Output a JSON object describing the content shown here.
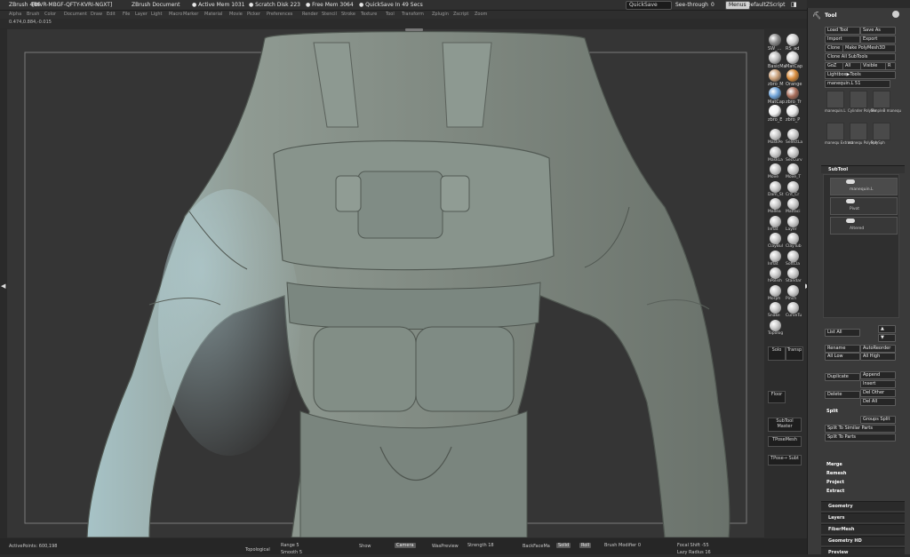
{
  "titlebar": {
    "app": "ZBrush 4R6",
    "serial": "[BIVR-MBGF-QFTY-KVRI-NGXT]",
    "document": "ZBrush Document",
    "active_mem": "● Active Mem 1031",
    "scratch": "● Scratch Disk 223",
    "free_mem": "● Free Mem 3064",
    "quicksave_in": "● QuickSave In 49 Secs",
    "quicksave_btn": "QuickSave",
    "see_through": "See-through",
    "see_through_val": "0",
    "menus_btn": "Menus",
    "script": "DefaultZScript"
  },
  "menus": [
    "Alpha",
    "Brush",
    "Color",
    "Document",
    "Draw",
    "Edit",
    "File",
    "Layer",
    "Light",
    "Macro",
    "Marker",
    "Material",
    "Movie",
    "Picker",
    "Preferences",
    "Render",
    "Stencil",
    "Stroke",
    "Texture",
    "Tool",
    "Transform",
    "Zplugin",
    "Zscript",
    "Zoom"
  ],
  "coords": "0.474,0.884,-0.015",
  "materials": [
    {
      "label": "SW_...",
      "color": "#8a8a8a"
    },
    {
      "label": "RS_ad",
      "color": "#cfcfcf"
    },
    {
      "label": "BasicMa",
      "color": "#bdbdbd"
    },
    {
      "label": "MatCap",
      "color": "#d7d7d7"
    },
    {
      "label": "zbro_M",
      "color": "#c9a07a"
    },
    {
      "label": "Orange",
      "color": "#d78a3a"
    },
    {
      "label": "MatCap",
      "color": "#6fa3d8"
    },
    {
      "label": "zbro_Tr",
      "color": "#a86d5a"
    },
    {
      "label": "zbro_E",
      "color": "#f2f2f2"
    },
    {
      "label": "zbro_P",
      "color": "#e8e8e8"
    }
  ],
  "brushes": [
    "MaskPe",
    "SelectLa",
    "MaskLa",
    "SecCurv",
    "Move",
    "Move_T",
    "Dam_St",
    "Crit_Cr",
    "Mallea",
    "Matfaci",
    "Inflat",
    "Layer",
    "ClayBul",
    "ClayTub",
    "Inflat",
    "SoftCla",
    "hPolish",
    "Standar",
    "Morph",
    "Pinch",
    "Snake",
    "CurveTu",
    "Topolog"
  ],
  "shelf_buttons": {
    "solo": "Solo",
    "transp": "Transp",
    "floor": "Floor",
    "subtool_master": "SubTool Master",
    "tposemesh": "TPoseMesh",
    "tpose_subt": "TPose→ Subt"
  },
  "bottom": {
    "active_points": "ActivePoints: 600,198",
    "topological": "Topological",
    "range": "Range 5",
    "smooth": "Smooth 5",
    "show": "Show",
    "camera": "Camera",
    "was_preview": "WasPreview",
    "strength": "Strength 18",
    "backface": "BackFaceMa",
    "solid": "Solid",
    "roll": "Roll",
    "brush_modifier": "Brush Modifier 0",
    "focal_shift": "Focal Shift -55",
    "lazy": "Lazy Radius 16"
  },
  "tool": {
    "title": "Tool",
    "load": "Load Tool",
    "save_as": "Save As",
    "import": "Import",
    "export": "Export",
    "clone": "Clone",
    "make_polymesh": "Make PolyMesh3D",
    "clone_all": "Clone All SubTools",
    "goz": "GoZ",
    "all": "All",
    "visible": "Visible",
    "r": "R",
    "lightbox": "Lightbox▶Tools",
    "current_tool": "manequin.L 51",
    "thumbs": [
      {
        "label": "manequin.L"
      },
      {
        "label": "Cylinder PolyMe"
      },
      {
        "label": "SimpleB manequ"
      },
      {
        "label": "manequ Extract"
      },
      {
        "label": "manequ PolySph"
      },
      {
        "label": "PolySph"
      }
    ],
    "subtool_title": "SubTool",
    "subtools": [
      "manequin.L",
      "Pivot",
      "Altered"
    ],
    "list_all": "List All",
    "rename": "Rename",
    "autoreorder": "AutoReorder",
    "all_low": "All Low",
    "all_high": "All High",
    "duplicate": "Duplicate",
    "append": "Append",
    "insert": "Insert",
    "delete": "Delete",
    "del_other": "Del Other",
    "del_all": "Del All",
    "split": "Split",
    "groups_split": "Groups Split",
    "split_similar": "Split To Similar Parts",
    "split_parts": "Split To Parts",
    "merge": "Merge",
    "remesh": "Remesh",
    "project": "Project",
    "extract": "Extract",
    "sections": [
      "Geometry",
      "Layers",
      "FiberMesh",
      "Geometry HD",
      "Preview"
    ]
  }
}
